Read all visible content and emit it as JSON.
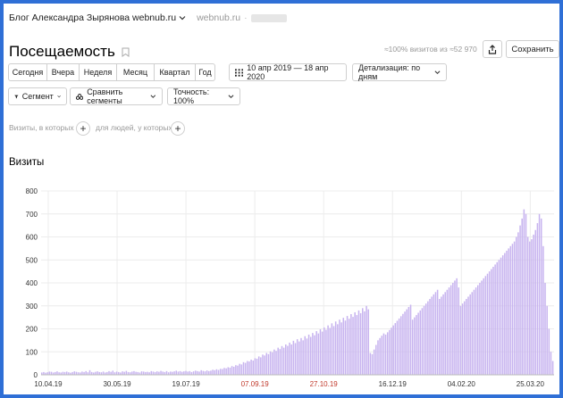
{
  "header": {
    "site_name": "Блог Александра Зырянова webnub.ru",
    "domain": "webnub.ru"
  },
  "page": {
    "title": "Посещаемость",
    "stats": "≈100% визитов из ≈52 970",
    "save_label": "Сохранить"
  },
  "periods": [
    "Сегодня",
    "Вчера",
    "Неделя",
    "Месяц",
    "Квартал",
    "Год"
  ],
  "date_range": "10 апр 2019 — 18 апр 2020",
  "detail": "Детализация: по дням",
  "segment": "Сегмент",
  "compare": "Сравнить сегменты",
  "accuracy": "Точность: 100%",
  "filters": {
    "visits_hint": "Визиты, в которых",
    "people_hint": "для людей, у которых"
  },
  "section_title": "Визиты",
  "chart_data": {
    "type": "bar",
    "title": "",
    "xlabel": "",
    "ylabel": "",
    "ylim": [
      0,
      800
    ],
    "yticks": [
      0,
      100,
      200,
      300,
      400,
      500,
      600,
      700,
      800
    ],
    "xticks": [
      {
        "label": "10.04.19",
        "weekend": false
      },
      {
        "label": "30.05.19",
        "weekend": false
      },
      {
        "label": "19.07.19",
        "weekend": false
      },
      {
        "label": "07.09.19",
        "weekend": true
      },
      {
        "label": "27.10.19",
        "weekend": true
      },
      {
        "label": "16.12.19",
        "weekend": false
      },
      {
        "label": "04.02.20",
        "weekend": false
      },
      {
        "label": "25.03.20",
        "weekend": false
      }
    ],
    "bar_color": "#c7b3ef",
    "grid": true,
    "series": [
      {
        "values": [
          10,
          12,
          9,
          11,
          14,
          13,
          10,
          12,
          15,
          11,
          10,
          13,
          12,
          14,
          11,
          9,
          12,
          15,
          13,
          11,
          10,
          14,
          12,
          16,
          11,
          20,
          12,
          10,
          13,
          15,
          12,
          11,
          14,
          10,
          12,
          16,
          13,
          18,
          11,
          14,
          12,
          10,
          15,
          13,
          17,
          12,
          11,
          14,
          16,
          13,
          12,
          10,
          15,
          14,
          12,
          13,
          11,
          16,
          14,
          12,
          15,
          13,
          17,
          14,
          12,
          16,
          11,
          14,
          13,
          15,
          18,
          14,
          16,
          13,
          15,
          17,
          14,
          16,
          12,
          15,
          18,
          16,
          14,
          20,
          17,
          15,
          19,
          16,
          18,
          22,
          20,
          24,
          21,
          26,
          25,
          30,
          28,
          33,
          31,
          38,
          35,
          42,
          40,
          48,
          45,
          55,
          52,
          60,
          58,
          66,
          62,
          72,
          70,
          80,
          76,
          88,
          84,
          95,
          90,
          102,
          98,
          110,
          104,
          118,
          112,
          125,
          118,
          132,
          126,
          140,
          132,
          148,
          138,
          155,
          145,
          160,
          150,
          168,
          158,
          175,
          165,
          182,
          172,
          190,
          180,
          198,
          188,
          206,
          196,
          215,
          204,
          224,
          212,
          232,
          220,
          240,
          228,
          248,
          236,
          256,
          244,
          264,
          252,
          272,
          260,
          280,
          268,
          290,
          276,
          300,
          285,
          95,
          90,
          110,
          130,
          150,
          160,
          170,
          180,
          175,
          185,
          195,
          205,
          215,
          225,
          235,
          245,
          255,
          265,
          275,
          285,
          295,
          305,
          240,
          250,
          260,
          270,
          280,
          290,
          300,
          310,
          320,
          330,
          340,
          350,
          360,
          370,
          330,
          340,
          350,
          360,
          370,
          380,
          390,
          400,
          410,
          420,
          380,
          300,
          310,
          320,
          330,
          340,
          350,
          360,
          370,
          380,
          390,
          400,
          410,
          420,
          430,
          440,
          450,
          460,
          470,
          480,
          490,
          500,
          510,
          520,
          530,
          540,
          550,
          560,
          570,
          580,
          600,
          620,
          650,
          680,
          720,
          700,
          600,
          580,
          590,
          610,
          630,
          660,
          700,
          680,
          560,
          400,
          300,
          200,
          100,
          60
        ]
      }
    ]
  }
}
